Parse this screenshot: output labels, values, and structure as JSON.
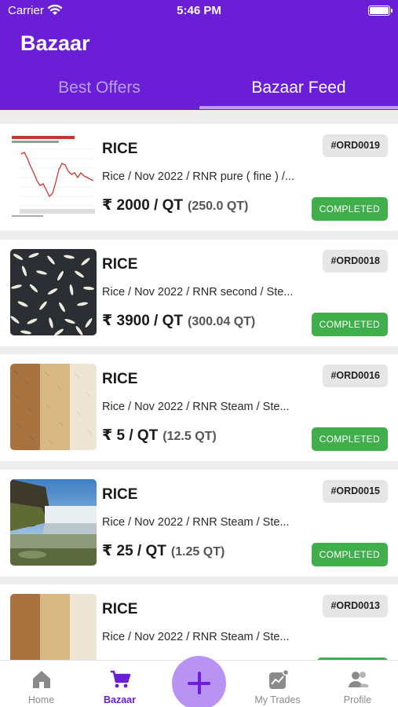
{
  "status_bar": {
    "carrier": "Carrier",
    "time": "5:46 PM"
  },
  "app": {
    "title": "Bazaar"
  },
  "tabs": [
    {
      "label": "Best Offers",
      "active": false
    },
    {
      "label": "Bazaar Feed",
      "active": true
    }
  ],
  "orders": [
    {
      "title": "RICE",
      "subtitle": "Rice / Nov 2022 / RNR pure ( fine ) /...",
      "price": "₹ 2000 / QT",
      "quantity": "(250.0 QT)",
      "order_id": "#ORD0019",
      "status": "COMPLETED",
      "thumbnail": "chart-image"
    },
    {
      "title": "RICE",
      "subtitle": "Rice / Nov 2022 / RNR second / Ste...",
      "price": "₹ 3900 / QT",
      "quantity": "(300.04 QT)",
      "order_id": "#ORD0018",
      "status": "COMPLETED",
      "thumbnail": "rice-grains-image"
    },
    {
      "title": "RICE",
      "subtitle": "Rice / Nov 2022 / RNR Steam / Ste...",
      "price": "₹ 5 / QT",
      "quantity": "(12.5 QT)",
      "order_id": "#ORD0016",
      "status": "COMPLETED",
      "thumbnail": "rice-varieties-image"
    },
    {
      "title": "RICE",
      "subtitle": "Rice / Nov 2022 / RNR Steam / Ste...",
      "price": "₹ 25 / QT",
      "quantity": "(1.25 QT)",
      "order_id": "#ORD0015",
      "status": "COMPLETED",
      "thumbnail": "waterfall-image"
    },
    {
      "title": "RICE",
      "subtitle": "Rice / Nov 2022 / RNR Steam / Ste...",
      "price": "",
      "quantity": "",
      "order_id": "#ORD0013",
      "status": "",
      "thumbnail": "rice-varieties-image"
    }
  ],
  "bottom_nav": [
    {
      "label": "Home",
      "icon": "home-icon",
      "active": false
    },
    {
      "label": "Bazaar",
      "icon": "cart-icon",
      "active": true
    },
    {
      "label": "My Trades",
      "icon": "trades-icon",
      "active": false
    },
    {
      "label": "Profile",
      "icon": "profile-icon",
      "active": false
    }
  ],
  "fab": {
    "icon": "plus-icon"
  },
  "colors": {
    "primary": "#6a1fd6",
    "tab_inactive": "#b9a0ee",
    "fab": "#b893f3",
    "status_completed": "#3fae4b"
  }
}
